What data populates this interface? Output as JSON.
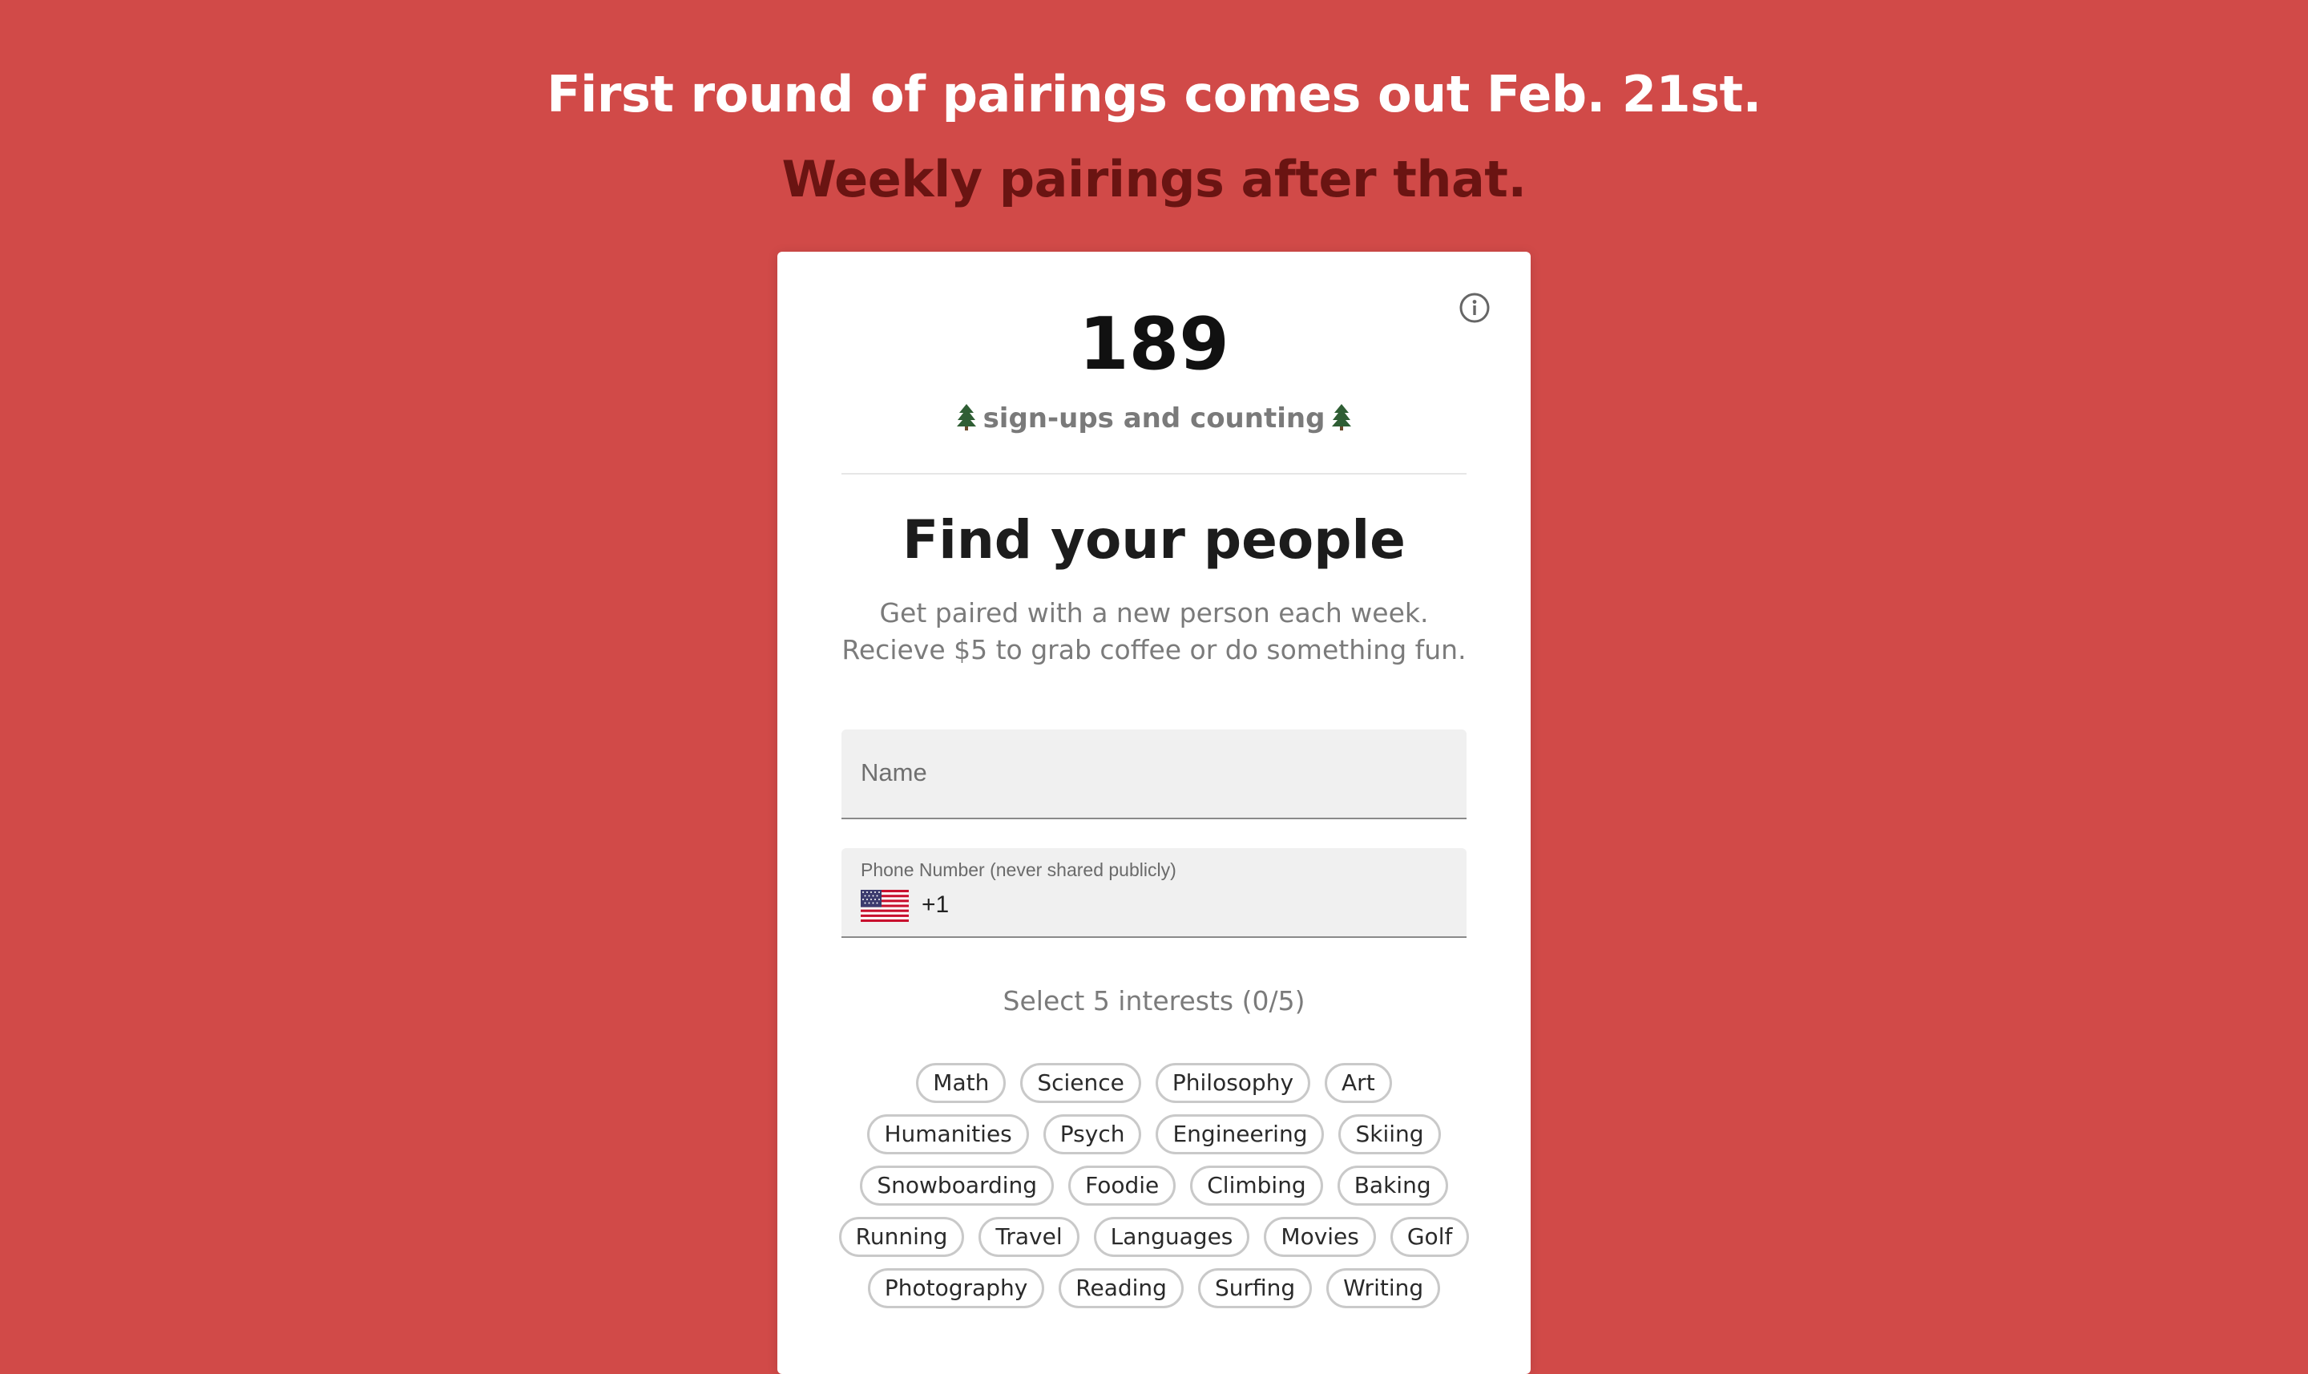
{
  "banner": {
    "line1": "First round of pairings comes out Feb. 21st.",
    "line2": "Weekly pairings after that."
  },
  "counter": {
    "value": "189",
    "label": "sign-ups and counting"
  },
  "card": {
    "title": "Find your people",
    "subtitle_line1": "Get paired with a new person each week.",
    "subtitle_line2": "Recieve $5 to grab coffee or do something fun."
  },
  "form": {
    "name_placeholder": "Name",
    "phone_label": "Phone Number (never shared publicly)",
    "phone_country_code": "+1",
    "interests_label": "Select 5 interests (0/5)"
  },
  "interests": [
    [
      "Math",
      "Science",
      "Philosophy",
      "Art"
    ],
    [
      "Humanities",
      "Psych",
      "Engineering",
      "Skiing"
    ],
    [
      "Snowboarding",
      "Foodie",
      "Climbing",
      "Baking"
    ],
    [
      "Running",
      "Travel",
      "Languages",
      "Movies",
      "Golf"
    ],
    [
      "Photography",
      "Reading",
      "Surfing",
      "Writing"
    ]
  ],
  "colors": {
    "background": "#d14a48",
    "headline_primary": "#ffffff",
    "headline_secondary": "#6a1412",
    "chip_border": "#c9c9c9"
  },
  "icons": {
    "info": "info-icon",
    "decorations": "tree-icon",
    "flag": "us-flag-icon"
  }
}
